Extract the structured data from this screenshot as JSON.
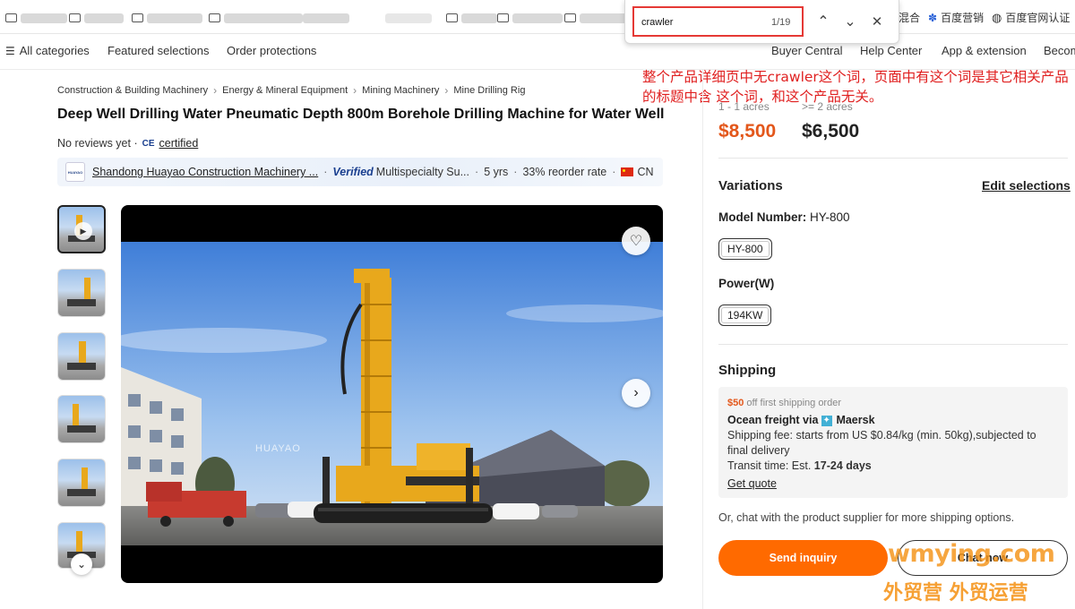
{
  "bookmarks": {
    "right_items": [
      {
        "label": "混合"
      },
      {
        "label": "百度营销"
      },
      {
        "label": "百度官网认证"
      }
    ]
  },
  "find_bar": {
    "query": "crawler",
    "count": "1/19"
  },
  "nav": {
    "left": [
      "All categories",
      "Featured selections",
      "Order protections"
    ],
    "right": [
      "Buyer Central",
      "Help Center",
      "App & extension",
      "Becom"
    ]
  },
  "annotation": "整个产品详细页中无crawler这个词，页面中有这个词是其它相关产品的标题中含 这个词，和这个产品无关。",
  "breadcrumb": [
    "Construction & Building Machinery",
    "Energy & Mineral Equipment",
    "Mining Machinery",
    "Mine Drilling Rig"
  ],
  "product": {
    "title": "Deep Well Drilling Water Pneumatic Depth 800m Borehole Drilling Machine for Water Well",
    "reviews": "No reviews yet ·",
    "certified": "certified",
    "image_watermark": "HUAYAO"
  },
  "supplier": {
    "logo_text": "HUAYAO",
    "name": "Shandong Huayao Construction Machinery ...",
    "verified": "Verified",
    "type": "Multispecialty Su...",
    "years": "5 yrs",
    "reorder": "33% reorder rate",
    "country": "CN"
  },
  "pricing": {
    "tiers": [
      {
        "range": "1 - 1 acres",
        "price": "$8,500"
      },
      {
        "range": ">= 2 acres",
        "price": "$6,500"
      }
    ]
  },
  "variations": {
    "title": "Variations",
    "edit": "Edit selections",
    "model_label": "Model Number:",
    "model_value": "HY-800",
    "model_chip": "HY-800",
    "power_label": "Power(W)",
    "power_chip": "194KW"
  },
  "shipping": {
    "title": "Shipping",
    "promo_amount": "$50",
    "promo_text": "off first shipping order",
    "method": "Ocean freight via",
    "carrier": "Maersk",
    "fee": "Shipping fee: starts from US $0.84/kg (min. 50kg),subjected to final delivery",
    "transit_label": "Transit time: Est.",
    "transit_days": "17-24 days",
    "quote": "Get quote",
    "chat_line": "Or, chat with the product supplier for more shipping options."
  },
  "actions": {
    "inquiry": "Send inquiry",
    "chat": "Chat now"
  },
  "watermark": {
    "domain": "wmying.com",
    "text": "外贸营 外贸运营"
  },
  "colors": {
    "accent": "#ff6a00",
    "price": "#e3571b",
    "annotation": "#e02020",
    "find_highlight": "#e53935"
  }
}
